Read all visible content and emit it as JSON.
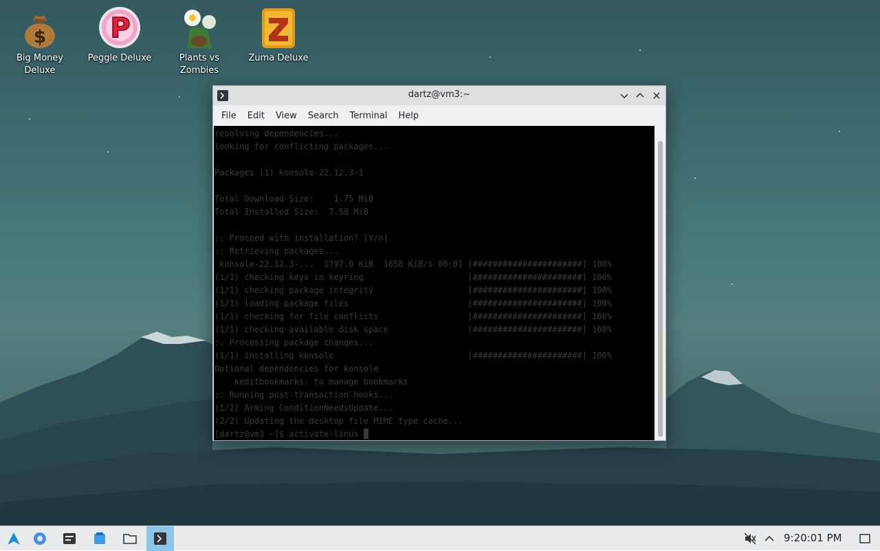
{
  "desktop": {
    "icons": [
      {
        "label": "Big Money\nDeluxe",
        "icon": "money-bag-icon"
      },
      {
        "label": "Peggle Deluxe",
        "icon": "peggle-icon"
      },
      {
        "label": "Plants vs\nZombies",
        "icon": "plants-vs-zombies-icon"
      },
      {
        "label": "Zuma Deluxe",
        "icon": "zuma-icon"
      }
    ]
  },
  "window": {
    "title": "dartz@vm3:~",
    "menu": [
      "File",
      "Edit",
      "View",
      "Search",
      "Terminal",
      "Help"
    ],
    "terminal_lines": [
      "resolving dependencies...",
      "looking for conflicting packages...",
      "",
      "Packages (1) konsole-22.12.3-1",
      "",
      "Total Download Size:    1.75 MiB",
      "Total Installed Size:  7.58 MiB",
      "",
      ":: Proceed with installation? [Y/n]",
      ":: Retrieving packages...",
      " konsole-22.12.3-...  1797.0 KiB  1658 KiB/s 00:01 [######################] 100%",
      "(1/1) checking keys in keyring                     [######################] 100%",
      "(1/1) checking package integrity                   [######################] 100%",
      "(1/1) loading package files                        [######################] 100%",
      "(1/1) checking for file conflicts                  [######################] 100%",
      "(1/1) checking available disk space                [######################] 100%",
      ":: Processing package changes...",
      "(1/1) installing konsole                           [######################] 100%",
      "Optional dependencies for konsole",
      "    keditbookmarks: to manage bookmarks",
      ":: Running post-transaction hooks...",
      "(1/2) Arming ConditionNeedsUpdate...",
      "(2/2) Updating the desktop file MIME type cache..."
    ],
    "prompt": "[dartz@vm3 ~]$ activate-linux "
  },
  "taskbar": {
    "clock": "9:20:01 PM",
    "launchers": [
      "arch-logo-icon",
      "browser-icon",
      "settings-icon",
      "software-store-icon",
      "folder-icon",
      "terminal-icon"
    ]
  },
  "colors": {
    "accent": "#8ec6e8",
    "terminal_bg": "#000000",
    "terminal_fg": "#3a3a3a"
  }
}
